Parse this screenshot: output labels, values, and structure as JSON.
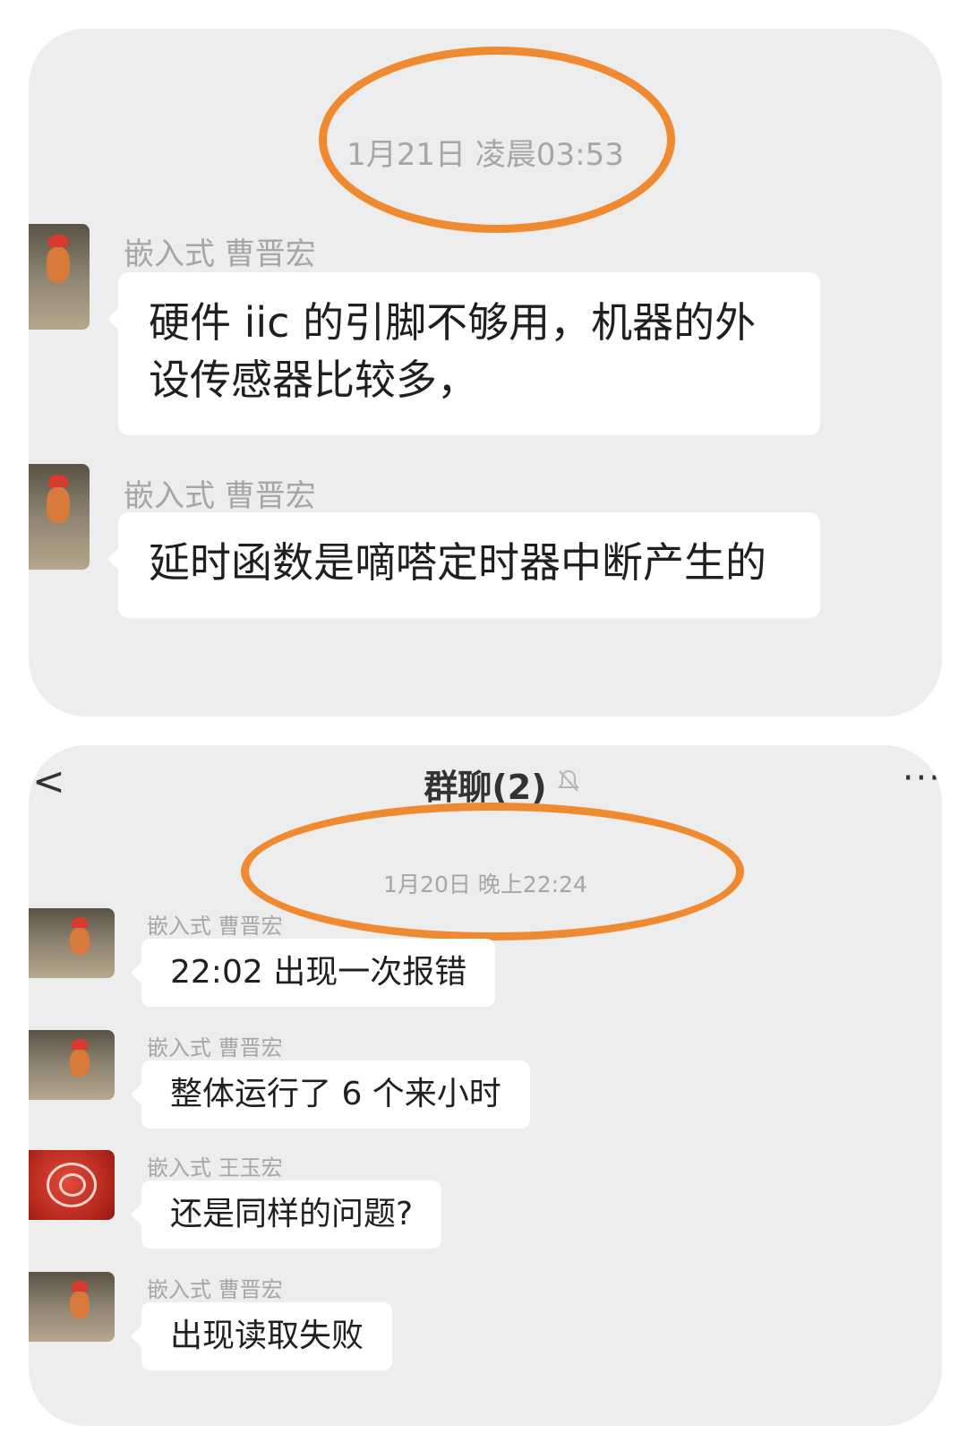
{
  "top_panel": {
    "timestamp": "1月21日 凌晨03:53",
    "messages": [
      {
        "sender": "嵌入式 曹晋宏",
        "line1": "硬件 iic 的引脚不够用，机器的外",
        "line2": "设传感器比较多，"
      },
      {
        "sender": "嵌入式 曹晋宏",
        "text": "延时函数是嘀嗒定时器中断产生的"
      }
    ]
  },
  "bottom_panel": {
    "header": {
      "back_icon": "<",
      "title": "群聊(2)",
      "bell_icon": "bell-muted-icon",
      "more_icon": "···"
    },
    "timestamp": "1月20日 晚上22:24",
    "messages": [
      {
        "sender": "嵌入式 曹晋宏",
        "text": "22:02 出现一次报错"
      },
      {
        "sender": "嵌入式 曹晋宏",
        "text": "整体运行了 6 个来小时"
      },
      {
        "sender": "嵌入式 王玉宏",
        "text": "还是同样的问题?"
      },
      {
        "sender": "嵌入式 曹晋宏",
        "text": "出现读取失败"
      }
    ]
  },
  "colors": {
    "highlight_oval": "#f08a30",
    "panel_bg": "#ededed",
    "bubble_bg": "#ffffff",
    "meta_text": "#a6a6a6"
  }
}
